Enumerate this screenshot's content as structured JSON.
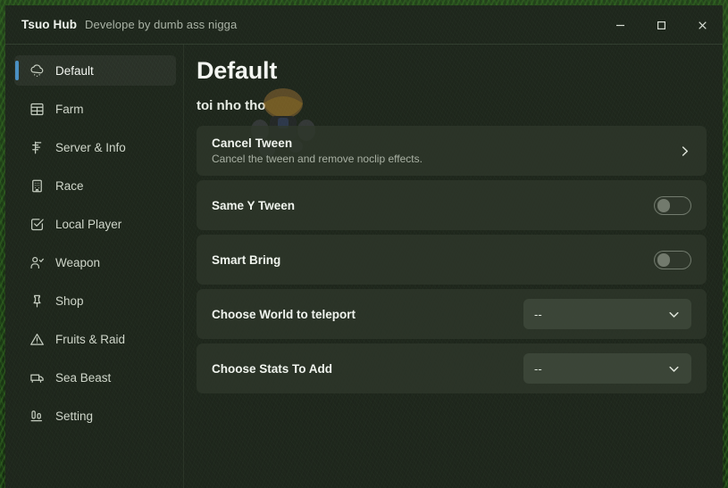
{
  "titlebar": {
    "app_name": "Tsuo Hub",
    "subtitle": "Develope by dumb ass nigga",
    "minimize_label": "Minimize",
    "maximize_label": "Maximize",
    "close_label": "Close"
  },
  "accent_color": "#4a90c2",
  "sidebar": {
    "items": [
      {
        "label": "Default",
        "icon": "cloud-snow-icon",
        "active": true
      },
      {
        "label": "Farm",
        "icon": "table-grid-icon",
        "active": false
      },
      {
        "label": "Server & Info",
        "icon": "server-node-icon",
        "active": false
      },
      {
        "label": "Race",
        "icon": "building-icon",
        "active": false
      },
      {
        "label": "Local Player",
        "icon": "check-square-icon",
        "active": false
      },
      {
        "label": "Weapon",
        "icon": "user-check-icon",
        "active": false
      },
      {
        "label": "Shop",
        "icon": "pin-icon",
        "active": false
      },
      {
        "label": "Fruits & Raid",
        "icon": "warning-triangle-icon",
        "active": false
      },
      {
        "label": "Sea Beast",
        "icon": "truck-icon",
        "active": false
      },
      {
        "label": "Setting",
        "icon": "sliders-icon",
        "active": false
      }
    ]
  },
  "main": {
    "title": "Default",
    "subtitle": "toi nho tho",
    "rows": [
      {
        "type": "action",
        "title": "Cancel Tween",
        "description": "Cancel the tween and remove noclip effects.",
        "icon": "chevron-right-icon"
      },
      {
        "type": "toggle",
        "title": "Same Y Tween",
        "value": "off"
      },
      {
        "type": "toggle",
        "title": "Smart Bring",
        "value": "off"
      },
      {
        "type": "dropdown",
        "title": "Choose World to teleport",
        "value": "--",
        "icon": "chevron-down-icon"
      },
      {
        "type": "dropdown",
        "title": "Choose Stats To Add",
        "value": "--",
        "icon": "chevron-down-icon"
      }
    ]
  }
}
